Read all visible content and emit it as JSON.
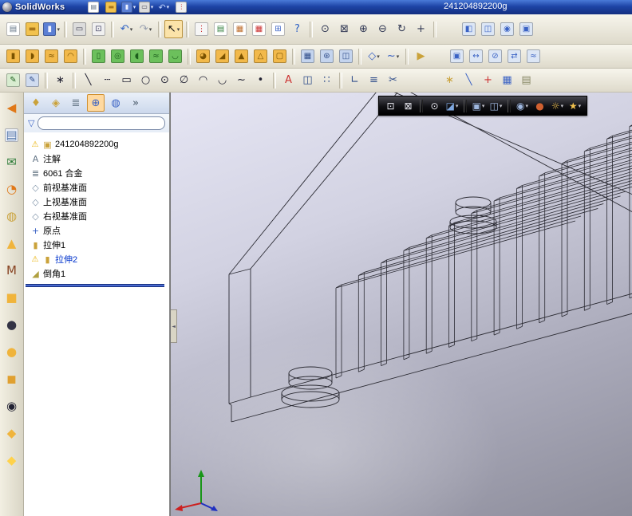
{
  "window": {
    "app_name": "SolidWorks",
    "document_name": "241204892200g"
  },
  "colors": {
    "titlebar_blue": "#1e44a6",
    "toolbar_face": "#ece9d8",
    "rollback_blue": "#4a6ad0",
    "viewport_top": "#e6e6f4",
    "viewport_bottom": "#8d8d9b",
    "hud_background": "#000000"
  },
  "toolbars": {
    "titlebar": [
      {
        "name": "new-document-button",
        "glyph": "▤",
        "fg": "#667788",
        "bg": "#ffffff"
      },
      {
        "name": "open-button",
        "glyph": "▬",
        "fg": "#a9761a",
        "bg": "#f2c24e"
      },
      {
        "name": "save-button",
        "glyph": "▮",
        "fg": "#eef2ff",
        "bg": "#5b7fd4",
        "dd": true
      },
      {
        "name": "print-button",
        "glyph": "▭",
        "fg": "#444455",
        "bg": "#dcdcdc",
        "dd": true
      },
      {
        "name": "undo-button",
        "glyph": "↶",
        "fg": "#bcd0ff",
        "dd": true
      },
      {
        "name": "rebuild-traffic-light-button",
        "glyph": "⋮",
        "fg": "#cc3333",
        "bg": "#f0f0f0"
      }
    ],
    "standard": [
      {
        "name": "new-document-button",
        "glyph": "▤",
        "fg": "#667788",
        "bg": "#ffffff"
      },
      {
        "name": "open-button",
        "glyph": "▬",
        "fg": "#a9761a",
        "bg": "#f2c24e"
      },
      {
        "name": "save-button",
        "glyph": "▮",
        "fg": "#eef2ff",
        "bg": "#5b7fd4",
        "dd": true
      },
      {
        "sep": true
      },
      {
        "name": "print-button",
        "glyph": "▭",
        "fg": "#444455",
        "bg": "#dcdcdc"
      },
      {
        "name": "print-preview-button",
        "glyph": "⊡",
        "fg": "#444466",
        "bg": "#f0f0f0"
      },
      {
        "sep": true
      },
      {
        "name": "undo-button",
        "glyph": "↶",
        "fg": "#2f62c4",
        "dd": true
      },
      {
        "name": "redo-button",
        "glyph": "↷",
        "fg": "#98a0b0",
        "dd": true
      },
      {
        "sep": true
      },
      {
        "name": "select-arrow-button",
        "glyph": "↖",
        "fg": "#111111",
        "pressed": true,
        "dd": true
      },
      {
        "sep": true
      },
      {
        "name": "rebuild-traffic-light-button",
        "glyph": "⋮",
        "fg": "#cc3333",
        "bg": "#f6f6f6"
      },
      {
        "name": "task-pane-button",
        "glyph": "▤",
        "fg": "#2f7d3a",
        "bg": "#ffffff"
      },
      {
        "name": "color-swatches-button",
        "glyph": "▦",
        "fg": "#c07030",
        "bg": "#ffffff"
      },
      {
        "name": "pattern-grid-button",
        "glyph": "▦",
        "fg": "#cc3333",
        "bg": "#ffffff"
      },
      {
        "name": "design-binder-button",
        "glyph": "⊞",
        "fg": "#3a62c4",
        "bg": "#ffffff"
      },
      {
        "name": "help-button",
        "glyph": "?",
        "fg": "#2f62c4"
      },
      {
        "sep": true
      },
      {
        "name": "zoom-to-fit-button",
        "glyph": "⊙",
        "fg": "#333a55"
      },
      {
        "name": "zoom-to-area-button",
        "glyph": "⊠",
        "fg": "#333a55"
      },
      {
        "name": "zoom-in-button",
        "glyph": "⊕",
        "fg": "#333a55"
      },
      {
        "name": "zoom-out-button",
        "glyph": "⊖",
        "fg": "#333a55"
      },
      {
        "name": "rotate-view-button",
        "glyph": "↻",
        "fg": "#333a55"
      },
      {
        "name": "pan-button",
        "glyph": "+",
        "fg": "#333a55"
      },
      {
        "sep": true
      },
      {
        "space": 24
      },
      {
        "name": "view-orientation-button",
        "glyph": "◧",
        "fg": "#3a62c4",
        "bg": "#dce6f5"
      },
      {
        "name": "display-style-button",
        "glyph": "◫",
        "fg": "#3a62c4",
        "bg": "#dce6f5"
      },
      {
        "name": "hide-show-items-button",
        "glyph": "◉",
        "fg": "#3a62c4",
        "bg": "#dce6f5"
      },
      {
        "name": "window-button",
        "glyph": "▣",
        "fg": "#3a62c4",
        "bg": "#dce6f5"
      }
    ],
    "features": [
      {
        "name": "extruded-boss-button",
        "glyph": "▮",
        "fg": "#7a5200",
        "bg": "#f2b94a"
      },
      {
        "name": "revolved-boss-button",
        "glyph": "◗",
        "fg": "#7a5200",
        "bg": "#f2b94a"
      },
      {
        "name": "swept-boss-button",
        "glyph": "≈",
        "fg": "#7a5200",
        "bg": "#f2b94a"
      },
      {
        "name": "lofted-boss-button",
        "glyph": "◠",
        "fg": "#7a5200",
        "bg": "#f2b94a"
      },
      {
        "sep": true
      },
      {
        "name": "extruded-cut-button",
        "glyph": "▯",
        "fg": "#1c5e1c",
        "bg": "#6cc05c"
      },
      {
        "name": "hole-wizard-button",
        "glyph": "◎",
        "fg": "#1c5e1c",
        "bg": "#6cc05c"
      },
      {
        "name": "revolved-cut-button",
        "glyph": "◖",
        "fg": "#1c5e1c",
        "bg": "#6cc05c"
      },
      {
        "name": "swept-cut-button",
        "glyph": "≈",
        "fg": "#1c5e1c",
        "bg": "#6cc05c"
      },
      {
        "name": "lofted-cut-button",
        "glyph": "◡",
        "fg": "#1c5e1c",
        "bg": "#6cc05c"
      },
      {
        "sep": true
      },
      {
        "name": "fillet-button",
        "glyph": "◕",
        "fg": "#7a5200",
        "bg": "#f2b94a"
      },
      {
        "name": "chamfer-button",
        "glyph": "◢",
        "fg": "#7a5200",
        "bg": "#f2b94a"
      },
      {
        "name": "rib-button",
        "glyph": "▲",
        "fg": "#7a5200",
        "bg": "#f2b94a"
      },
      {
        "name": "draft-button",
        "glyph": "△",
        "fg": "#7a5200",
        "bg": "#f2b94a"
      },
      {
        "name": "shell-button",
        "glyph": "▢",
        "fg": "#7a5200",
        "bg": "#f2b94a"
      },
      {
        "sep": true
      },
      {
        "name": "linear-pattern-button",
        "glyph": "▦",
        "fg": "#2f4d8a",
        "bg": "#c4d4ee"
      },
      {
        "name": "circular-pattern-button",
        "glyph": "⊛",
        "fg": "#2f4d8a",
        "bg": "#c4d4ee"
      },
      {
        "name": "mirror-button",
        "glyph": "◫",
        "fg": "#2f4d8a",
        "bg": "#c4d4ee"
      },
      {
        "sep": true
      },
      {
        "name": "reference-geometry-button",
        "glyph": "◇",
        "fg": "#3a62c4",
        "dd": true
      },
      {
        "name": "curves-button",
        "glyph": "~",
        "fg": "#3a62c4",
        "dd": true
      },
      {
        "sep": true
      },
      {
        "name": "instant3d-button",
        "glyph": "▶",
        "fg": "#caa23a"
      },
      {
        "space": 20
      },
      {
        "name": "insert-part-button",
        "glyph": "▣",
        "fg": "#3a62c4",
        "bg": "#dce6f5"
      },
      {
        "name": "move-copy-body-button",
        "glyph": "↔",
        "fg": "#3a62c4",
        "bg": "#dce6f5"
      },
      {
        "name": "delete-face-button",
        "glyph": "⊘",
        "fg": "#3a62c4",
        "bg": "#dce6f5"
      },
      {
        "name": "replace-face-button",
        "glyph": "⇄",
        "fg": "#3a62c4",
        "bg": "#dce6f5"
      },
      {
        "name": "freeform-button",
        "glyph": "≈",
        "fg": "#3a62c4",
        "bg": "#dce6f5"
      }
    ],
    "sketch": [
      {
        "name": "sketch-button",
        "glyph": "✎",
        "fg": "#1c5e1c",
        "bg": "#d8ecd0"
      },
      {
        "name": "3d-sketch-button",
        "glyph": "✎",
        "fg": "#2f4d8a",
        "bg": "#d0dcf0"
      },
      {
        "sep": true
      },
      {
        "name": "smart-dimension-button",
        "glyph": "∗",
        "fg": "#222233"
      },
      {
        "sep": true
      },
      {
        "name": "line-button",
        "glyph": "╲",
        "fg": "#222233"
      },
      {
        "name": "centerline-button",
        "glyph": "┄",
        "fg": "#222233"
      },
      {
        "name": "rectangle-button",
        "glyph": "▭",
        "fg": "#222233"
      },
      {
        "name": "circle-button",
        "glyph": "○",
        "fg": "#222233"
      },
      {
        "name": "perimeter-circle-button",
        "glyph": "⊙",
        "fg": "#222233"
      },
      {
        "name": "ellipse-button",
        "glyph": "∅",
        "fg": "#222233"
      },
      {
        "name": "centerpoint-arc-button",
        "glyph": "◠",
        "fg": "#222233"
      },
      {
        "name": "tangent-arc-button",
        "glyph": "◡",
        "fg": "#222233"
      },
      {
        "name": "spline-button",
        "glyph": "~",
        "fg": "#222233"
      },
      {
        "name": "point-button",
        "glyph": "•",
        "fg": "#222233"
      },
      {
        "sep": true
      },
      {
        "name": "sketch-text-button",
        "glyph": "A",
        "fg": "#cc3333"
      },
      {
        "name": "mirror-entities-button",
        "glyph": "◫",
        "fg": "#2f4d8a"
      },
      {
        "name": "linear-sketch-pattern-button",
        "glyph": "∷",
        "fg": "#2f4d8a"
      },
      {
        "sep": true
      },
      {
        "name": "convert-entities-button",
        "glyph": "∟",
        "fg": "#2f4d8a"
      },
      {
        "name": "offset-entities-button",
        "glyph": "≡",
        "fg": "#2f4d8a"
      },
      {
        "name": "trim-entities-button",
        "glyph": "✂",
        "fg": "#2f4d8a"
      },
      {
        "space": 46
      },
      {
        "name": "quick-snaps-button",
        "glyph": "∗",
        "fg": "#caa23a"
      },
      {
        "name": "snap-line-button",
        "glyph": "╲",
        "fg": "#3a62c4"
      },
      {
        "name": "snap-point-button",
        "glyph": "+",
        "fg": "#cc3333"
      },
      {
        "name": "snap-grid-button",
        "glyph": "▦",
        "fg": "#3a62c4"
      },
      {
        "name": "clipboard-button",
        "glyph": "▤",
        "fg": "#888866"
      }
    ],
    "left_vertical": [
      {
        "name": "arrow-tool-button",
        "glyph": "◀",
        "fg": "#e07818"
      },
      {
        "name": "sheets-tool-button",
        "glyph": "▤",
        "fg": "#5577aa",
        "bg": "#eef2fa"
      },
      {
        "name": "mail-tool-button",
        "glyph": "✉",
        "fg": "#2f7d3a"
      },
      {
        "name": "clock-tool-button",
        "glyph": "◔",
        "fg": "#e07818"
      },
      {
        "name": "bell-tool-button",
        "glyph": "◍",
        "fg": "#caa23a"
      },
      {
        "name": "pyramid-tool-button",
        "glyph": "▲",
        "fg": "#f0b43c"
      },
      {
        "name": "macro-tool-button",
        "glyph": "M",
        "fg": "#884422"
      },
      {
        "name": "box-tool-button",
        "glyph": "■",
        "fg": "#f0b43c"
      },
      {
        "name": "sphere-dark-tool-button",
        "glyph": "●",
        "fg": "#333344"
      },
      {
        "name": "sphere-gold-tool-button",
        "glyph": "●",
        "fg": "#f0b43c"
      },
      {
        "name": "cube-tool-button",
        "glyph": "◼",
        "fg": "#e0a030"
      },
      {
        "name": "ring-tool-button",
        "glyph": "◉",
        "fg": "#222233"
      },
      {
        "name": "diamond-tool-button",
        "glyph": "◆",
        "fg": "#f0b43c"
      },
      {
        "name": "gem-tool-button",
        "glyph": "◆",
        "fg": "#ffd24a"
      }
    ],
    "heads_up": [
      {
        "name": "zoom-to-fit-button",
        "glyph": "⊡",
        "fg": "#e8e8f0"
      },
      {
        "name": "zoom-to-area-button",
        "glyph": "⊠",
        "fg": "#e8e8f0"
      },
      {
        "sep": true
      },
      {
        "name": "magnifier-button",
        "glyph": "⊙",
        "fg": "#e8e8f0"
      },
      {
        "name": "section-view-button",
        "glyph": "◪",
        "fg": "#7fa8e0",
        "dd": true
      },
      {
        "sep": true
      },
      {
        "name": "view-orientation-button",
        "glyph": "▣",
        "fg": "#9fb8e0",
        "dd": true
      },
      {
        "name": "display-style-button",
        "glyph": "◫",
        "fg": "#9fb8e0",
        "dd": true
      },
      {
        "sep": true
      },
      {
        "name": "hide-show-items-button",
        "glyph": "◉",
        "fg": "#9fb8e0",
        "dd": true
      },
      {
        "name": "edit-appearance-button",
        "glyph": "●",
        "fg": "#d06030"
      },
      {
        "name": "apply-scene-button",
        "glyph": "☼",
        "fg": "#f2c24e",
        "dd": true
      },
      {
        "name": "view-settings-button",
        "glyph": "★",
        "fg": "#f2c24e",
        "dd": true
      }
    ]
  },
  "feature_tree": {
    "tabs": [
      {
        "name": "featuremanager-tab",
        "glyph": "♦",
        "fg": "#caa23a"
      },
      {
        "name": "propertymanager-tab",
        "glyph": "◈",
        "fg": "#caa23a"
      },
      {
        "name": "configurationmanager-tab",
        "glyph": "≣",
        "fg": "#667788"
      },
      {
        "name": "dimxpertmanager-tab",
        "glyph": "⊕",
        "fg": "#3a62c4",
        "active": true
      },
      {
        "name": "displaymanager-tab",
        "glyph": "◍",
        "fg": "#3a62c4"
      },
      {
        "name": "tabs-overflow-chevron",
        "glyph": "»",
        "fg": "#445566"
      }
    ],
    "filter_value": "",
    "tree_icons": {
      "part": {
        "glyph": "▣",
        "fg": "#caa23a"
      },
      "annotations": {
        "glyph": "A",
        "fg": "#667788"
      },
      "material": {
        "glyph": "≣",
        "fg": "#556677"
      },
      "plane": {
        "glyph": "◇",
        "fg": "#7f93a8"
      },
      "origin": {
        "glyph": "+",
        "fg": "#3a62c4"
      },
      "extrude": {
        "glyph": "▮",
        "fg": "#caa23a"
      },
      "chamfer": {
        "glyph": "◢",
        "fg": "#b0a040"
      },
      "warning": {
        "glyph": "⚠",
        "fg": "#e8b000"
      }
    },
    "items": [
      {
        "id": "part-root",
        "icon": "part",
        "warn": true,
        "label": "241204892200g"
      },
      {
        "id": "annotations",
        "icon": "annotations",
        "label": "注解"
      },
      {
        "id": "material",
        "icon": "material",
        "label": "6061 合金"
      },
      {
        "id": "front-plane",
        "icon": "plane",
        "label": "前视基准面"
      },
      {
        "id": "top-plane",
        "icon": "plane",
        "label": "上视基准面"
      },
      {
        "id": "right-plane",
        "icon": "plane",
        "label": "右视基准面"
      },
      {
        "id": "origin",
        "icon": "origin",
        "label": "原点"
      },
      {
        "id": "extrude1",
        "icon": "extrude",
        "label": "拉伸1"
      },
      {
        "id": "extrude2",
        "icon": "extrude",
        "warn": true,
        "label": "拉伸2",
        "label_color": "#0033cc"
      },
      {
        "id": "chamfer1",
        "icon": "chamfer",
        "label": "倒角1"
      }
    ]
  },
  "viewport": {
    "edge_color": "#2b2b33",
    "triad": {
      "x_color": "#cc2020",
      "y_color": "#189618",
      "z_color": "#2030c0"
    }
  }
}
